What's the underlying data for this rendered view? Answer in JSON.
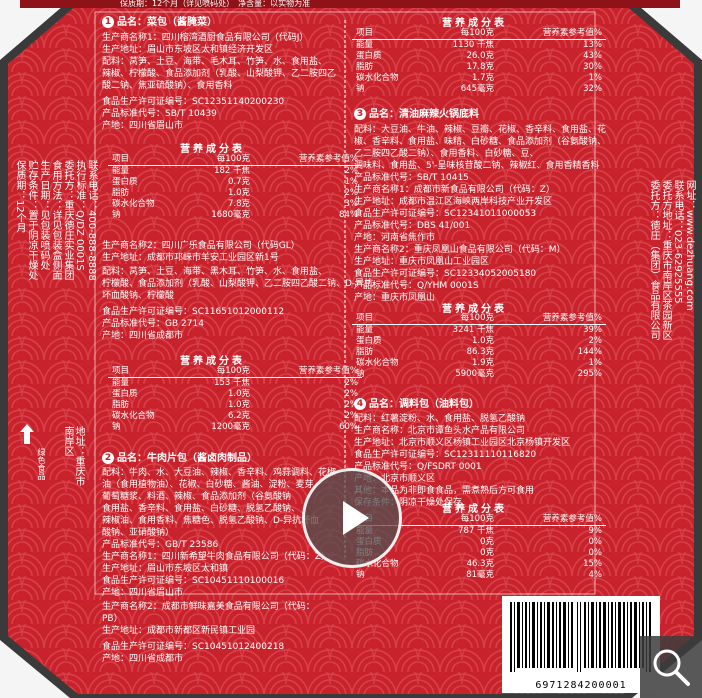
{
  "colors": {
    "red": "#c8232c",
    "dark_red": "#8e1318",
    "pattern": "#d9414a",
    "frame": "#3a3a3a",
    "white": "#ffffff"
  },
  "top_strip": "保质期：12个月（详见喷码处）　净含量：以实物为准",
  "section1": {
    "num": "1",
    "title": "品名：菜包（酱腌菜）",
    "lines": [
      "生产商名称1：四川榕湾酒厨食品有限公司（代码J）",
      "生产地址：眉山市东坡区太和镇经济开发区",
      "配料：莴笋、土豆、海带、毛木耳、竹笋、水、食用盐、",
      "辣椒、柠檬酸、食品添加剂（乳酸、山梨酸钾、乙二胺四乙",
      "酸二钠、焦亚硫酸钠）、食用香料",
      "食品生产许可证编号：SC12351140200230",
      "产品标准代号：SB/T 10439",
      "产地：四川省眉山市"
    ]
  },
  "nut_headers": [
    "项目",
    "每100克",
    "营养素参考值%"
  ],
  "nut_title": "营养成分表",
  "nut_table1": [
    [
      "能量",
      "182 千焦",
      "2%"
    ],
    [
      "蛋白质",
      "0.7克",
      "1%"
    ],
    [
      "脂肪",
      "1.0克",
      "2%"
    ],
    [
      "碳水化合物",
      "7.8克",
      "3%"
    ],
    [
      "钠",
      "1680毫克",
      "84%"
    ]
  ],
  "section1b": {
    "lines": [
      "生产商名称2：四川广乐食品有限公司（代码GL）",
      "生产地址：成都市邛崃市羊安工业园区新1号",
      "配料：莴笋、土豆、海带、黑木耳、竹笋、水、食用盐、",
      "柠檬酸、食品添加剂（乳酸、山梨酸钾、乙二胺四乙酸二钠、D-异抗",
      "坏血酸钠、柠檬酸",
      "食品生产许可证编号：SC11651012000112",
      "产品标准代号：GB 2714",
      "产地：四川省成都市"
    ]
  },
  "nut_table2": [
    [
      "能量",
      "153 千焦",
      "2%"
    ],
    [
      "蛋白质",
      "1.0克",
      "2%"
    ],
    [
      "脂肪",
      "1.0克",
      "2%"
    ],
    [
      "碳水化合物",
      "6.2克",
      "2%"
    ],
    [
      "钠",
      "1200毫克",
      "60%"
    ]
  ],
  "section2": {
    "num": "2",
    "title": "品名：牛肉片包（酱卤肉制品）",
    "lines": [
      "配料：牛肉、水、大豆油、辣椒、香辛料、鸡蒜调料、花椒",
      "油（食用植物油）、花椒、白砂糖、酱油、淀粉、麦芽",
      "葡萄糖浆、料酒、辣椒、食品添加剂（谷氨酸钠",
      "食用盐、香辛料、食用盐、白砂糖、脱氢乙酸钠、",
      "辣椒油、食用香料、焦糖色、脱氢乙酸钠、D-异抗坏血",
      "酸钠、亚硝酸钠）",
      "产品标准代号：GB/T 23586",
      "生产商名称1：四川新希望牛肉食品有限公司（代码：Z）",
      "生产地址：眉山市东坡区太和镇",
      "食品生产许可证编号：SC10451110100016",
      "产地：四川省眉山市",
      "生产商名称2：成都市鲜味嘉美食品有限公司（代码：",
      "PB）",
      "生产地址：成都市新都区新民镇工业园",
      "食品生产许可证编号：SC10451012400218",
      "产地：四川省成都市"
    ]
  },
  "right_top_table": [
    [
      "能量",
      "1130 千焦",
      "13%"
    ],
    [
      "蛋白质",
      "26.0克",
      "43%"
    ],
    [
      "脂肪",
      "17.8克",
      "30%"
    ],
    [
      "碳水化合物",
      "1.7克",
      "1%"
    ],
    [
      "钠",
      "645毫克",
      "32%"
    ]
  ],
  "section3": {
    "num": "3",
    "title": "品名：清油麻辣火锅底料",
    "lines": [
      "配料：大豆油、牛油、辣椒、豆瓣、花椒、香辛料、食用盐、花",
      "椒、香辛料、食用盐、味精、白砂糖、食品添加剂（谷氨酸钠、",
      "乙二胺四乙酸二钠）、食用香料、白砂糖、豆、",
      "调味料、食用盐、5'-呈味核苷酸二钠、辣椒红、食用香精香料",
      "产品标准代号：SB/T 10415",
      "生产商名称1：成都市新食品有限公司（代码：Z）",
      "生产地址：成都市温江区海峡两岸科技产业开发区",
      "食品生产许可证编号：SC12341011000053",
      "产品标准代号：DBS 41/001",
      "产地：河南省焦作市",
      "生产商名称2：重庆凤凰山食品有限公司（代码：M）",
      "生产地址：重庆市凤凰山工业园区",
      "食品生产许可证编号：SC12334052005180",
      "产品标准代号：Q/YHM 0001S",
      "产地：重庆市凤凰山"
    ]
  },
  "nut_table3": [
    [
      "能量",
      "3241 千焦",
      "39%"
    ],
    [
      "蛋白质",
      "1.0克",
      "2%"
    ],
    [
      "脂肪",
      "86.3克",
      "144%"
    ],
    [
      "碳水化合物",
      "1.9克",
      "1%"
    ],
    [
      "钠",
      "5900毫克",
      "295%"
    ]
  ],
  "section4": {
    "num": "4",
    "title": "品名：调料包（油料包）",
    "lines": [
      "配料：红薯淀粉、水、食用盐、脱氢乙酸钠",
      "生产商名称：北京市谭鱼头水产品有限公司",
      "生产地址：北京市顺义区杨镇工业园区北京杨镇开发区",
      "食品生产许可证编号：SC12311110116820",
      "产品标准代号：Q/FSDRT 0001",
      "产地：北京市顺义区",
      "其他：本品为非即食食品，需煮熟后方可食用",
      "保存条件：阴凉干燥处保存"
    ]
  },
  "nut_table4": [
    [
      "能量",
      "787 千焦",
      "9%"
    ],
    [
      "蛋白质",
      "0克",
      "0%"
    ],
    [
      "脂肪",
      "0克",
      "0%"
    ],
    [
      "碳水化合物",
      "46.3克",
      "15%"
    ],
    [
      "钠",
      "81毫克",
      "4%"
    ]
  ],
  "left_vertical": [
    "保质期：12个月",
    "贮存条件：置于阴凉干燥处",
    "生产日期：见包装喷码处",
    "食用方法：详见包装盒侧面",
    "委托方：重庆德庄实业集团",
    "执行标准：Q/DZ 0001S",
    "联系电话：400-888-8888",
    "地址：重庆市南岸区"
  ],
  "left_logo": "绿色食品",
  "right_vertical": [
    "委托方：德庄（集团）食品有限公司",
    "委托方地址：重庆市南岸区茶园新区",
    "联系电话：023-62925555",
    "网址：www.dezhuang.com"
  ],
  "barcode": "6971284200001",
  "video": {
    "play_label": "播放视频"
  },
  "zoom": {
    "label": "放大图片"
  }
}
